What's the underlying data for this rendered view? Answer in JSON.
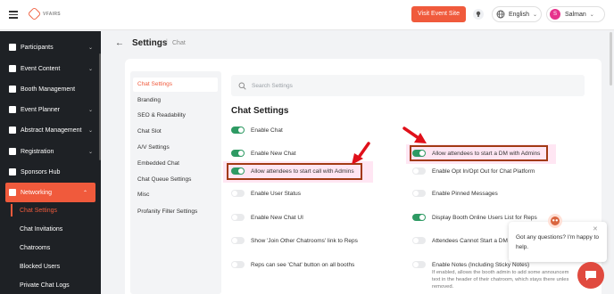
{
  "topbar": {
    "logo_text": "VFAIRS",
    "visit_button": "Visit Event Site",
    "language": "English",
    "user_initial": "S",
    "user_name": "Salman"
  },
  "sidebar": {
    "items": [
      {
        "label": "Participants",
        "chevron": "⌄"
      },
      {
        "label": "Event Content",
        "chevron": "⌄"
      },
      {
        "label": "Booth Management",
        "chevron": ""
      },
      {
        "label": "Event Planner",
        "chevron": "⌄"
      },
      {
        "label": "Abstract Management",
        "chevron": "⌄"
      },
      {
        "label": "Registration",
        "chevron": "⌄"
      },
      {
        "label": "Sponsors Hub",
        "chevron": ""
      },
      {
        "label": "Networking",
        "chevron": "⌃"
      }
    ],
    "sub_items": [
      {
        "label": "Chat Settings"
      },
      {
        "label": "Chat Invitations"
      },
      {
        "label": "Chatrooms"
      },
      {
        "label": "Blocked Users"
      },
      {
        "label": "Private Chat Logs"
      }
    ]
  },
  "page": {
    "title": "Settings",
    "separator": "|",
    "crumb": "Chat"
  },
  "subnav": {
    "items": [
      "Chat Settings",
      "Branding",
      "SEO & Readability",
      "Chat Slot",
      "A/V Settings",
      "Embedded Chat",
      "Chat Queue Settings",
      "Misc",
      "Profanity Filter Settings"
    ]
  },
  "search": {
    "placeholder": "Search Settings"
  },
  "section_title": "Chat Settings",
  "options_left": [
    {
      "label": "Enable Chat",
      "on": true
    },
    {
      "label": "Enable New Chat",
      "on": true
    },
    {
      "label": "Allow attendees to start call with Admins",
      "on": true
    },
    {
      "label": "Enable User Status",
      "on": false
    },
    {
      "label": "Enable New Chat UI",
      "on": false
    },
    {
      "label": "Show 'Join Other Chatrooms' link to Reps",
      "on": false
    },
    {
      "label": "Reps can see 'Chat' button on all booths",
      "on": false
    }
  ],
  "options_right": [
    {
      "label": "Allow attendees to start a DM with Admins",
      "on": true
    },
    {
      "label": "Enable Opt In/Opt Out for Chat Platform",
      "on": false
    },
    {
      "label": "Enable Pinned Messages",
      "on": false
    },
    {
      "label": "Display Booth Online Users List for Reps",
      "on": true
    },
    {
      "label": "Attendees Cannot Start a DM",
      "on": false
    },
    {
      "label": "Enable Notes (Including Sticky Notes)",
      "on": false
    }
  ],
  "notes_description": {
    "line1": "If enabled, allows the booth admin to add some announcem",
    "line2": "text in the header of their chatroom, which stays there unles",
    "line3": "removed."
  },
  "chat_widget": {
    "message": "Got any questions? I'm happy to help.",
    "close": "✕"
  },
  "colors": {
    "accent": "#f05a3c",
    "toggle_on": "#2e9a63",
    "highlight_border": "#a23a14",
    "annotation_arrow": "#e0101a",
    "sidebar_bg": "#1e2125"
  }
}
